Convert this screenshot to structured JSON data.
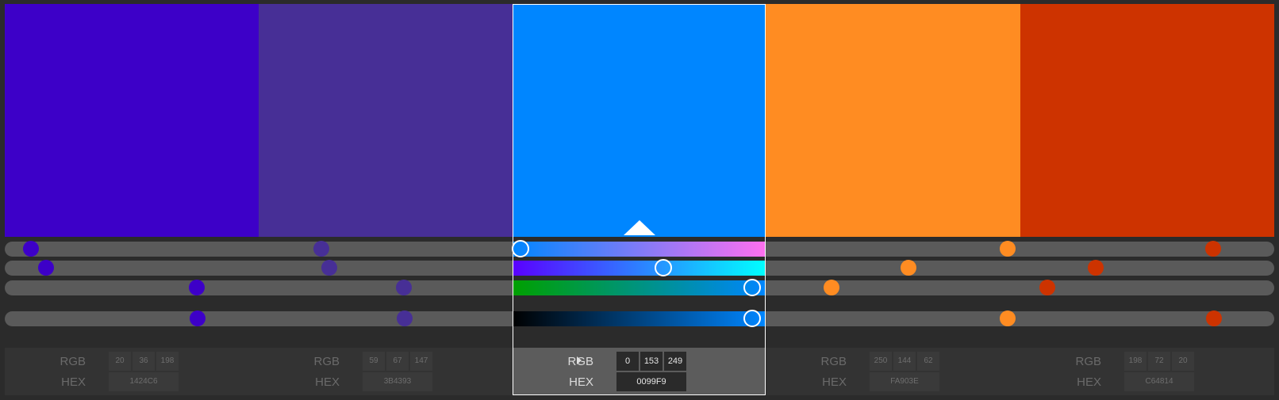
{
  "palette": {
    "colors": [
      {
        "hex": "#3D00C8",
        "swatch_label": "color-1"
      },
      {
        "hex": "#472F96",
        "swatch_label": "color-2"
      },
      {
        "hex": "#0086FF",
        "swatch_label": "color-3"
      },
      {
        "hex": "#FF8C22",
        "swatch_label": "color-4"
      },
      {
        "hex": "#CD3300",
        "swatch_label": "color-5"
      }
    ],
    "selected_index": 2
  },
  "panels": [
    {
      "rgb_label": "RGB",
      "hex_label": "HEX",
      "r": "20",
      "g": "36",
      "b": "198",
      "hex": "1424C6",
      "selected": false
    },
    {
      "rgb_label": "RGB",
      "hex_label": "HEX",
      "r": "59",
      "g": "67",
      "b": "147",
      "hex": "3B4393",
      "selected": false
    },
    {
      "rgb_label": "RGB",
      "hex_label": "HEX",
      "r": "0",
      "g": "153",
      "b": "249",
      "hex": "0099F9",
      "selected": true
    },
    {
      "rgb_label": "RGB",
      "hex_label": "HEX",
      "r": "250",
      "g": "144",
      "b": "62",
      "hex": "FA903E",
      "selected": false
    },
    {
      "rgb_label": "RGB",
      "hex_label": "HEX",
      "r": "198",
      "g": "72",
      "b": "20",
      "hex": "C64814",
      "selected": false
    }
  ],
  "sliders": {
    "rows": [
      {
        "name": "hue-slider",
        "values": [
          0.02,
          0.25,
          0.0,
          0.79,
          0.95
        ]
      },
      {
        "name": "saturation-slider",
        "values": [
          0.03,
          0.26,
          0.58,
          0.71,
          0.86
        ]
      },
      {
        "name": "lightness-slider",
        "values": [
          0.15,
          0.31,
          0.94,
          0.65,
          0.82
        ]
      },
      {
        "name": "brightness-slider",
        "values": [
          0.15,
          0.31,
          0.94,
          0.79,
          0.96
        ]
      }
    ],
    "selected_gradients": [
      [
        "#0086FF",
        "#FF6FEF"
      ],
      [
        "#5A00FF",
        "#00FFFF"
      ],
      [
        "#00A000",
        "#0086FF"
      ],
      [
        "#000000",
        "#0086FF"
      ]
    ]
  }
}
